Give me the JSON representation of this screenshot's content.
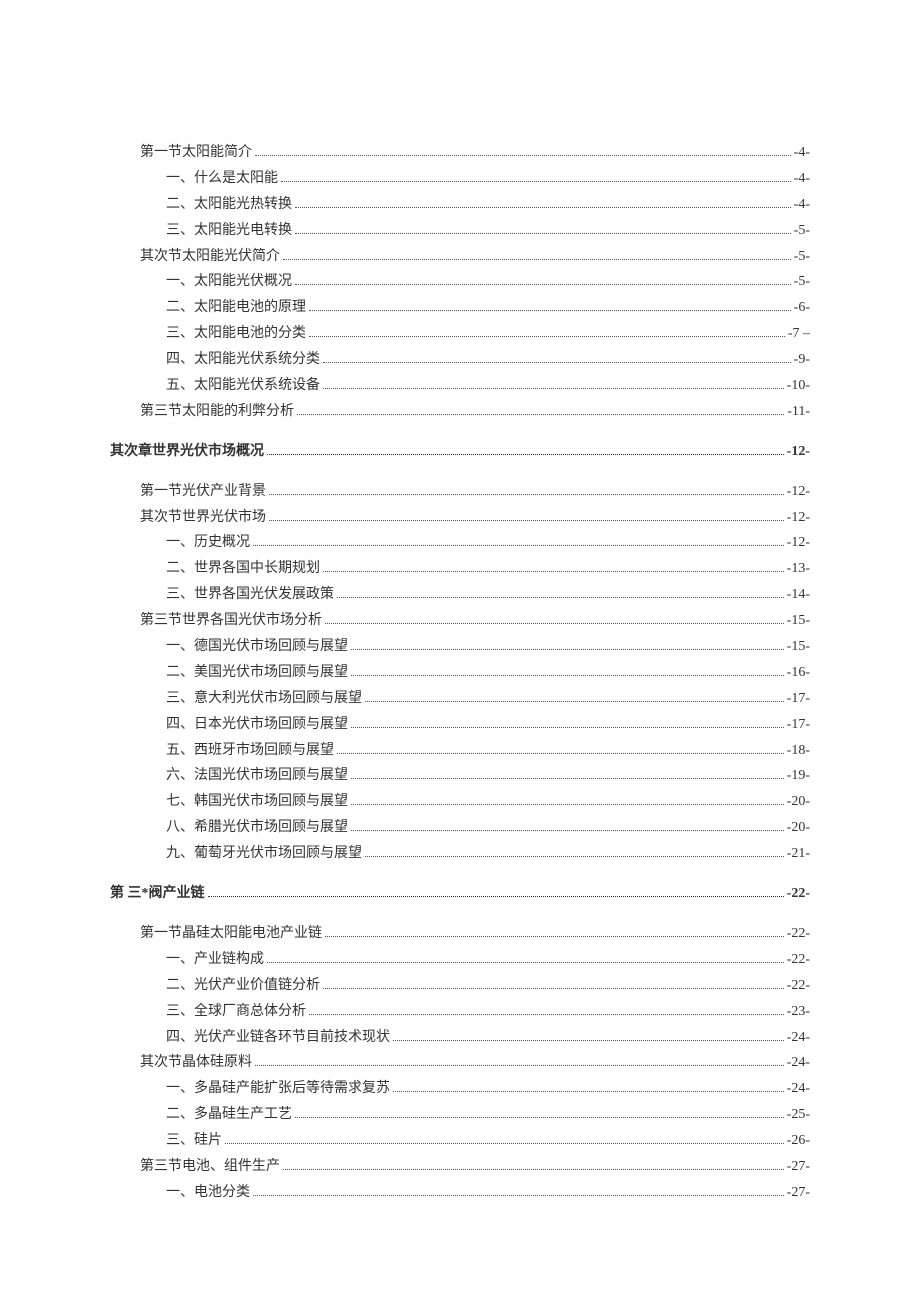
{
  "toc": [
    {
      "level": 1,
      "label": "第一节太阳能简介",
      "page": "-4-"
    },
    {
      "level": 2,
      "label": "一、什么是太阳能",
      "page": "-4-"
    },
    {
      "level": 2,
      "label": "二、太阳能光热转换",
      "page": "-4-"
    },
    {
      "level": 2,
      "label": "三、太阳能光电转换",
      "page": "-5-"
    },
    {
      "level": 1,
      "label": "其次节太阳能光伏简介",
      "page": "-5-"
    },
    {
      "level": 2,
      "label": "一、太阳能光伏概况",
      "page": "-5-"
    },
    {
      "level": 2,
      "label": "二、太阳能电池的原理",
      "page": "-6-"
    },
    {
      "level": 2,
      "label": "三、太阳能电池的分类",
      "page": "-7 –"
    },
    {
      "level": 2,
      "label": "四、太阳能光伏系统分类",
      "page": "-9-"
    },
    {
      "level": 2,
      "label": "五、太阳能光伏系统设备",
      "page": "-10-"
    },
    {
      "level": 1,
      "label": "第三节太阳能的利弊分析",
      "page": "-11-"
    },
    {
      "level": 0,
      "label": "其次章世界光伏市场概况",
      "page": "-12-"
    },
    {
      "level": 1,
      "label": "第一节光伏产业背景",
      "page": "-12-"
    },
    {
      "level": 1,
      "label": "其次节世界光伏市场",
      "page": "-12-"
    },
    {
      "level": 2,
      "label": "一、历史概况",
      "page": "-12-"
    },
    {
      "level": 2,
      "label": "二、世界各国中长期规划",
      "page": "-13-"
    },
    {
      "level": 2,
      "label": "三、世界各国光伏发展政策",
      "page": "-14-"
    },
    {
      "level": 1,
      "label": "第三节世界各国光伏市场分析",
      "page": "-15-"
    },
    {
      "level": 2,
      "label": "一、德国光伏市场回顾与展望",
      "page": "-15-"
    },
    {
      "level": 2,
      "label": "二、美国光伏市场回顾与展望",
      "page": "-16-"
    },
    {
      "level": 2,
      "label": "三、意大利光伏市场回顾与展望",
      "page": "-17-"
    },
    {
      "level": 2,
      "label": "四、日本光伏市场回顾与展望",
      "page": "-17-"
    },
    {
      "level": 2,
      "label": "五、西班牙市场回顾与展望",
      "page": "-18-"
    },
    {
      "level": 2,
      "label": "六、法国光伏市场回顾与展望",
      "page": "-19-"
    },
    {
      "level": 2,
      "label": "七、韩国光伏市场回顾与展望",
      "page": "-20-"
    },
    {
      "level": 2,
      "label": "八、希腊光伏市场回顾与展望",
      "page": "-20-"
    },
    {
      "level": 2,
      "label": "九、葡萄牙光伏市场回顾与展望",
      "page": "-21-"
    },
    {
      "level": 0,
      "label": "第 三*阀产业链",
      "page": "-22-"
    },
    {
      "level": 1,
      "label": "第一节晶硅太阳能电池产业链",
      "page": "-22-"
    },
    {
      "level": 2,
      "label": "一、产业链构成",
      "page": "-22-"
    },
    {
      "level": 2,
      "label": "二、光伏产业价值链分析",
      "page": "-22-"
    },
    {
      "level": 2,
      "label": "三、全球厂商总体分析",
      "page": "-23-"
    },
    {
      "level": 2,
      "label": "四、光伏产业链各环节目前技术现状",
      "page": "-24-"
    },
    {
      "level": 1,
      "label": "其次节晶体硅原料",
      "page": "-24-"
    },
    {
      "level": 2,
      "label": "一、多晶硅产能扩张后等待需求复苏",
      "page": "-24-"
    },
    {
      "level": 2,
      "label": "二、多晶硅生产工艺",
      "page": "-25-"
    },
    {
      "level": 2,
      "label": "三、硅片",
      "page": "-26-"
    },
    {
      "level": 1,
      "label": "第三节电池、组件生产",
      "page": "-27-"
    },
    {
      "level": 2,
      "label": "一、电池分类",
      "page": "-27-"
    }
  ]
}
